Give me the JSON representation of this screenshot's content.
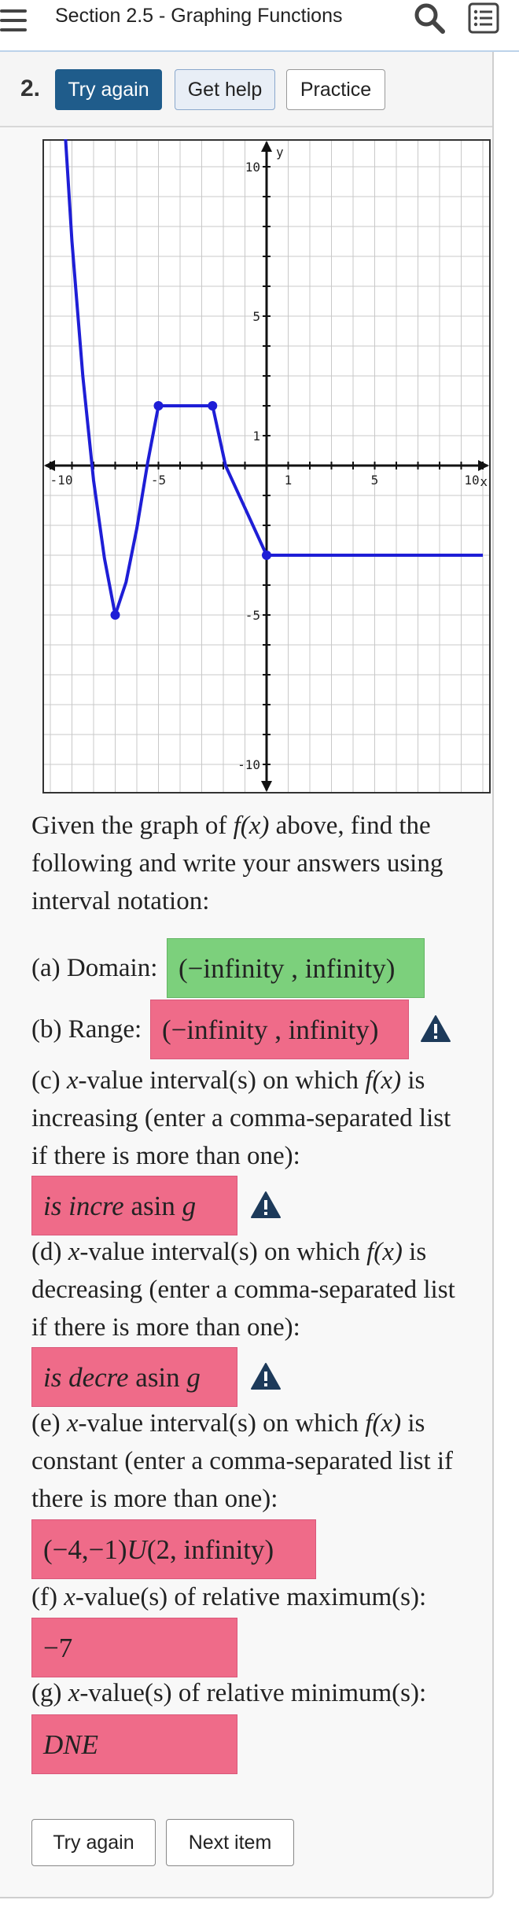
{
  "header": {
    "title": "Section 2.5 - Graphing Functions"
  },
  "question": {
    "number": "2.",
    "buttons": {
      "try_again": "Try again",
      "get_help": "Get help",
      "practice": "Practice"
    }
  },
  "graph": {
    "x_axis_label": "x",
    "y_axis_label": "y",
    "x_ticks": [
      "-10",
      "-5",
      "1",
      "5",
      "10"
    ],
    "y_ticks": [
      "10",
      "5",
      "1",
      "-5",
      "-10"
    ],
    "x_range": [
      -10,
      10
    ],
    "y_range": [
      -10,
      10
    ],
    "curve_color": "#1e1ed6",
    "curve_points": [
      [
        -9.3,
        11
      ],
      [
        -9,
        7.5
      ],
      [
        -8.5,
        3
      ],
      [
        -8,
        -0.5
      ],
      [
        -7.5,
        -3.1
      ],
      [
        -7,
        -5
      ],
      [
        -6.5,
        -3.9
      ],
      [
        -6,
        -2.1
      ],
      [
        -5.5,
        0.1
      ],
      [
        -5,
        2
      ],
      [
        -2.5,
        2
      ],
      [
        -1.9,
        0
      ],
      [
        0,
        -3
      ],
      [
        10,
        -3
      ]
    ],
    "highlighted_points": [
      [
        -7,
        -5
      ],
      [
        -5,
        2
      ],
      [
        -2.5,
        2
      ],
      [
        0,
        -3
      ]
    ]
  },
  "problem": {
    "intro_pre": "Given the graph of",
    "fx": "f(x)",
    "intro_post": "above, find the",
    "intro_line2": "following and write your answers using",
    "intro_line3": "interval notation:",
    "a_label": "(a) Domain:",
    "a_answer": "(−infinity , infinity)",
    "b_label": "(b) Range:",
    "b_answer": "(−infinity , infinity)",
    "c_line1_pre": "(c)",
    "c_line1_x": "x",
    "c_line1_mid": "-value interval(s) on which",
    "c_line1_fx": "f(x)",
    "c_line1_post": "is",
    "c_line2": "increasing (enter a comma-separated list",
    "c_line3": "if there is more than one):",
    "c_answer_italic": "is incre",
    "c_answer_tail": "asin",
    "c_answer_g": "g",
    "d_line1_pre": "(d)",
    "d_line1_x": "x",
    "d_line1_mid": "-value interval(s) on which",
    "d_line1_fx": "f(x)",
    "d_line1_post": "is",
    "d_line2": "decreasing (enter a comma-separated list",
    "d_line3": "if there is more than one):",
    "d_answer_italic": "is decre",
    "d_answer_tail": "asin",
    "d_answer_g": "g",
    "e_line1_pre": "(e)",
    "e_line1_x": "x",
    "e_line1_mid": "-value interval(s) on which",
    "e_line1_fx": "f(x)",
    "e_line1_post": "is",
    "e_line2": "constant (enter a comma-separated list if",
    "e_line3": "there is more than one):",
    "e_answer_a": "(−4,−1)",
    "e_answer_u": "U",
    "e_answer_b": "(2, infinity)",
    "f_pre": "(f)",
    "f_x": "x",
    "f_post": "-value(s) of relative maximum(s):",
    "f_answer": "−7",
    "g_pre": "(g)",
    "g_x": "x",
    "g_post": "-value(s) of relative minimum(s):",
    "g_answer": "DNE"
  },
  "footer": {
    "try_again": "Try again",
    "next_item": "Next item"
  },
  "colors": {
    "primary": "#1f5c8b",
    "correct": "#7cd07c",
    "incorrect": "#ef6b89",
    "warning_icon": "#1d3a5a"
  }
}
